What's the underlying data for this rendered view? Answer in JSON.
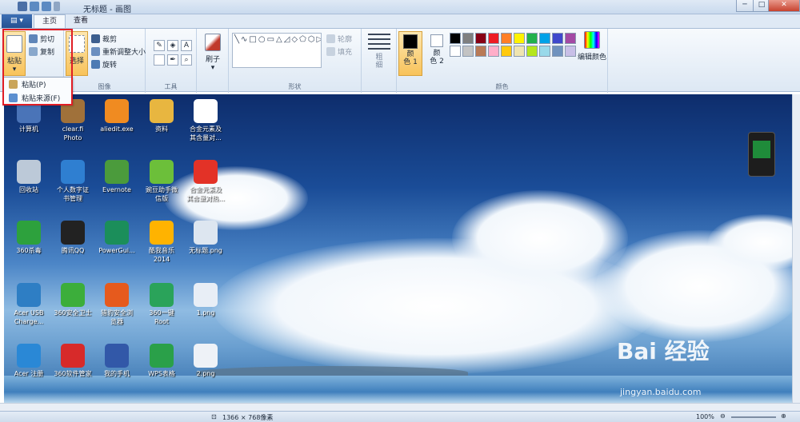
{
  "window": {
    "title": "无标题 - 画图",
    "minimize": "─",
    "maximize": "□",
    "close": "✕"
  },
  "tabs": {
    "app_menu": "▤ ▾",
    "home": "主页",
    "view": "查看"
  },
  "ribbon": {
    "clipboard": {
      "paste": "粘贴",
      "cut": "剪切",
      "copy": "复制"
    },
    "image": {
      "select": "选择",
      "crop": "裁剪",
      "resize": "重新调整大小",
      "rotate": "旋转",
      "label": "图像"
    },
    "tools": {
      "label": "工具",
      "text_tool": "A"
    },
    "brushes": {
      "label": "刷子"
    },
    "shapes": {
      "glyphs": "╲∿□○▭△◿◇⬠⬡▷◁▽◁✦✧☆✡⬭◯♡⚡",
      "outline": "轮廓",
      "fill": "填充",
      "label": "形状"
    },
    "size": {
      "label": "粗\n细"
    },
    "colors": {
      "color1": "颜\n色 1",
      "color2": "颜\n色 2",
      "edit": "编辑颜色",
      "label": "颜色",
      "palette": [
        "#000000",
        "#7f7f7f",
        "#880015",
        "#ed1c24",
        "#ff7f27",
        "#fff200",
        "#22b14c",
        "#00a2e8",
        "#3f48cc",
        "#a349a4",
        "#ffffff",
        "#c3c3c3",
        "#b97a57",
        "#ffaec9",
        "#ffc90e",
        "#efe4b0",
        "#b5e61d",
        "#99d9ea",
        "#7092be",
        "#c8bfe7"
      ]
    }
  },
  "paste_menu": {
    "item1": "粘贴(P)",
    "item2": "粘贴来源(F)"
  },
  "desktop": {
    "icons": [
      {
        "label": "计算机",
        "color": "#4a74b8"
      },
      {
        "label": "clear.fi\nPhoto",
        "color": "#a0713a"
      },
      {
        "label": "aliedit.exe",
        "color": "#f08b21"
      },
      {
        "label": "资料",
        "color": "#e8b640"
      },
      {
        "label": "合金元素及\n其含量对...",
        "color": "#ffffff"
      },
      {
        "label": "回收站",
        "color": "#bcc9d8"
      },
      {
        "label": "个人数字证\n书管理",
        "color": "#2f7fd1"
      },
      {
        "label": "Evernote",
        "color": "#4b9b3c"
      },
      {
        "label": "豌豆助手微\n信版",
        "color": "#6cbf3a"
      },
      {
        "label": "合金元素及\n其含量对热...",
        "color": "#e33227"
      },
      {
        "label": "360杀毒",
        "color": "#2da13d"
      },
      {
        "label": "腾讯QQ",
        "color": "#222222"
      },
      {
        "label": "PowerGui...",
        "color": "#1b8e5a"
      },
      {
        "label": "酷我音乐\n2014",
        "color": "#ffb300"
      },
      {
        "label": "无标题.png",
        "color": "#dde6f0"
      },
      {
        "label": "Acer USB\nCharge...",
        "color": "#2e7ec4"
      },
      {
        "label": "360安全卫士",
        "color": "#3cae3b"
      },
      {
        "label": "猎豹安全浏\n览器",
        "color": "#e65a1d"
      },
      {
        "label": "360一键\nRoot",
        "color": "#2aa35a"
      },
      {
        "label": "1.png",
        "color": "#e8eef6"
      },
      {
        "label": "Acer 注册",
        "color": "#2a88d6"
      },
      {
        "label": "360软件管家",
        "color": "#d72a2a"
      },
      {
        "label": "我的手机",
        "color": "#3258a8"
      },
      {
        "label": "WPS表格",
        "color": "#2aa049"
      },
      {
        "label": "2.png",
        "color": "#eef2f7"
      }
    ],
    "watermark": "Bai 经验",
    "watermark_url": "jingyan.baidu.com"
  },
  "status": {
    "dimensions": "1366 × 768像素",
    "zoom": "100%",
    "zoom_minus": "⊖",
    "zoom_plus": "⊕"
  }
}
